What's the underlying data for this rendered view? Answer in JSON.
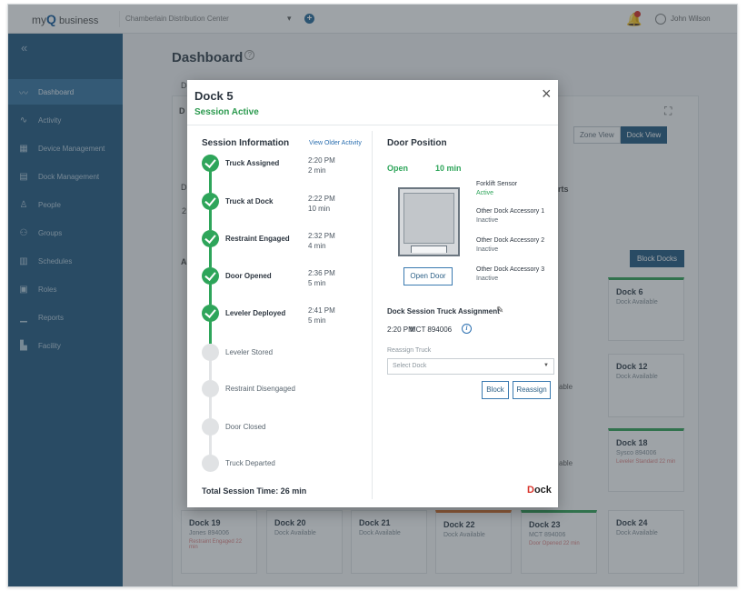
{
  "topbar": {
    "logo_prefix": "my",
    "logo_q": "Q",
    "logo_suffix": " business",
    "facility": "Chamberlain Distribution Center",
    "user": "John Wilson"
  },
  "sidebar": {
    "collapse": "«",
    "items": [
      {
        "label": "Dashboard",
        "icon": "dashboard-icon",
        "glyph": "〰",
        "active": true
      },
      {
        "label": "Activity",
        "icon": "activity-icon",
        "glyph": "∿",
        "active": false
      },
      {
        "label": "Device Management",
        "icon": "device-icon",
        "glyph": "▦",
        "active": false
      },
      {
        "label": "Dock Management",
        "icon": "dock-icon",
        "glyph": "▤",
        "active": false
      },
      {
        "label": "People",
        "icon": "person-icon",
        "glyph": "♙",
        "active": false
      },
      {
        "label": "Groups",
        "icon": "groups-icon",
        "glyph": "⚇",
        "active": false
      },
      {
        "label": "Schedules",
        "icon": "calendar-icon",
        "glyph": "▥",
        "active": false
      },
      {
        "label": "Roles",
        "icon": "roles-icon",
        "glyph": "▣",
        "active": false
      },
      {
        "label": "Reports",
        "icon": "reports-icon",
        "glyph": "▁",
        "active": false
      },
      {
        "label": "Facility",
        "icon": "facility-icon",
        "glyph": "▙",
        "active": false
      }
    ]
  },
  "main": {
    "title": "Dashboard",
    "help": "?",
    "tabs": [
      "Zone View",
      "Dock View"
    ],
    "block_docks": "Block Docks",
    "fragments": {
      "de": "De",
      "d": "D",
      "a": "A",
      "rts": "rts",
      "able1": "able",
      "able2": "able",
      "d2": "D",
      "n2": "2"
    }
  },
  "dock_cards": [
    {
      "name": "Dock 6",
      "status": "Dock Available",
      "extra": ""
    },
    {
      "name": "Dock 12",
      "status": "Dock Available",
      "extra": ""
    },
    {
      "name": "Dock 18",
      "status": "Sysco 894006",
      "extra": "Leveler Standard 22 min"
    },
    {
      "name": "Dock 19",
      "status": "Jones 894006",
      "extra": "Restraint Engaged 22 min"
    },
    {
      "name": "Dock 20",
      "status": "Dock Available",
      "extra": ""
    },
    {
      "name": "Dock 21",
      "status": "Dock Available",
      "extra": ""
    },
    {
      "name": "Dock 22",
      "status": "Dock Available",
      "extra": ""
    },
    {
      "name": "Dock 23",
      "status": "MCT 894006",
      "extra": "Door Opened 22 min"
    },
    {
      "name": "Dock 24",
      "status": "Dock Available",
      "extra": ""
    }
  ],
  "modal": {
    "title": "Dock 5",
    "subtitle": "Session Active",
    "close": "×",
    "session_title": "Session Information",
    "older_link": "View Older Activity",
    "steps": [
      {
        "label": "Truck Assigned",
        "time": "2:20 PM",
        "duration": "2 min",
        "done": true
      },
      {
        "label": "Truck at Dock",
        "time": "2:22 PM",
        "duration": "10 min",
        "done": true
      },
      {
        "label": "Restraint Engaged",
        "time": "2:32 PM",
        "duration": "4 min",
        "done": true
      },
      {
        "label": "Door Opened",
        "time": "2:36 PM",
        "duration": "5 min",
        "done": true
      },
      {
        "label": "Leveler Deployed",
        "time": "2:41 PM",
        "duration": "5 min",
        "done": true
      },
      {
        "label": "Leveler Stored",
        "time": "",
        "duration": "",
        "done": false
      },
      {
        "label": "Restraint Disengaged",
        "time": "",
        "duration": "",
        "done": false
      },
      {
        "label": "Door Closed",
        "time": "",
        "duration": "",
        "done": false
      },
      {
        "label": "Truck Departed",
        "time": "",
        "duration": "",
        "done": false
      }
    ],
    "total": "Total Session Time:  26 min",
    "door_title": "Door Position",
    "door_status": "Open",
    "door_duration": "10 min",
    "open_door_label": "Open Door",
    "accessories": [
      {
        "name": "Forklift Sensor",
        "status": "Active"
      },
      {
        "name": "Other Dock Accessory 1",
        "status": "Inactive"
      },
      {
        "name": "Other Dock Accessory 2",
        "status": "Inactive"
      },
      {
        "name": "Other Dock Accessory 3",
        "status": "Inactive"
      }
    ],
    "assign_title": "Dock Session Truck Assignment",
    "assign_time": "2:20 PM",
    "assign_truck": "MCT 894006",
    "reassign_label": "Reassign Truck",
    "select_placeholder": "Select Dock",
    "block_label": "Block",
    "reassign_btn": "Reassign",
    "brand_prefix": "D",
    "brand_suffix": "ock"
  },
  "colors": {
    "sidebar": "#2b5f86",
    "accent_green": "#2ea55a",
    "link_blue": "#2b6fb0"
  }
}
